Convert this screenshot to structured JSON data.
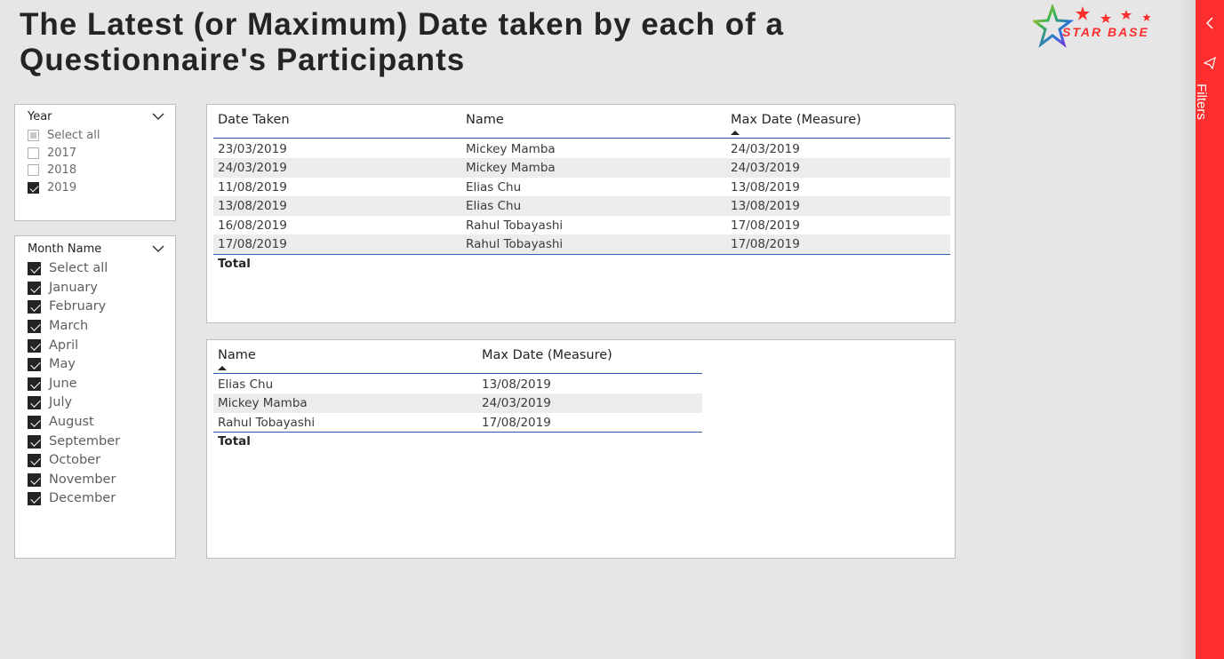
{
  "page_title": "The Latest (or Maximum) Date taken by each of a Questionnaire's Participants",
  "logo": {
    "text": "STAR BASE"
  },
  "year_slicer": {
    "title": "Year",
    "options": [
      {
        "label": "Select all",
        "state": "partial"
      },
      {
        "label": "2017",
        "state": "unchecked"
      },
      {
        "label": "2018",
        "state": "unchecked"
      },
      {
        "label": "2019",
        "state": "checked"
      }
    ]
  },
  "month_slicer": {
    "title": "Month Name",
    "options": [
      {
        "label": "Select all",
        "state": "checked"
      },
      {
        "label": "January",
        "state": "checked"
      },
      {
        "label": "February",
        "state": "checked"
      },
      {
        "label": "March",
        "state": "checked"
      },
      {
        "label": "April",
        "state": "checked"
      },
      {
        "label": "May",
        "state": "checked"
      },
      {
        "label": "June",
        "state": "checked"
      },
      {
        "label": "July",
        "state": "checked"
      },
      {
        "label": "August",
        "state": "checked"
      },
      {
        "label": "September",
        "state": "checked"
      },
      {
        "label": "October",
        "state": "checked"
      },
      {
        "label": "November",
        "state": "checked"
      },
      {
        "label": "December",
        "state": "checked"
      }
    ]
  },
  "detail_table": {
    "columns": [
      "Date Taken",
      "Name",
      "Max Date (Measure)"
    ],
    "sorted_column": "Max Date (Measure)",
    "rows": [
      [
        "23/03/2019",
        "Mickey Mamba",
        "24/03/2019"
      ],
      [
        "24/03/2019",
        "Mickey Mamba",
        "24/03/2019"
      ],
      [
        "11/08/2019",
        "Elias Chu",
        "13/08/2019"
      ],
      [
        "13/08/2019",
        "Elias Chu",
        "13/08/2019"
      ],
      [
        "16/08/2019",
        "Rahul Tobayashi",
        "17/08/2019"
      ],
      [
        "17/08/2019",
        "Rahul Tobayashi",
        "17/08/2019"
      ]
    ],
    "total_label": "Total"
  },
  "summary_table": {
    "columns": [
      "Name",
      "Max Date (Measure)"
    ],
    "sorted_column": "Name",
    "rows": [
      [
        "Elias Chu",
        "13/08/2019"
      ],
      [
        "Mickey Mamba",
        "24/03/2019"
      ],
      [
        "Rahul Tobayashi",
        "17/08/2019"
      ]
    ],
    "total_label": "Total"
  },
  "filters_pane": {
    "label": "Filters",
    "color": "#ff2e2e",
    "collapse_icon": "chevron-left-icon",
    "filter_icon": "funnel-icon"
  }
}
